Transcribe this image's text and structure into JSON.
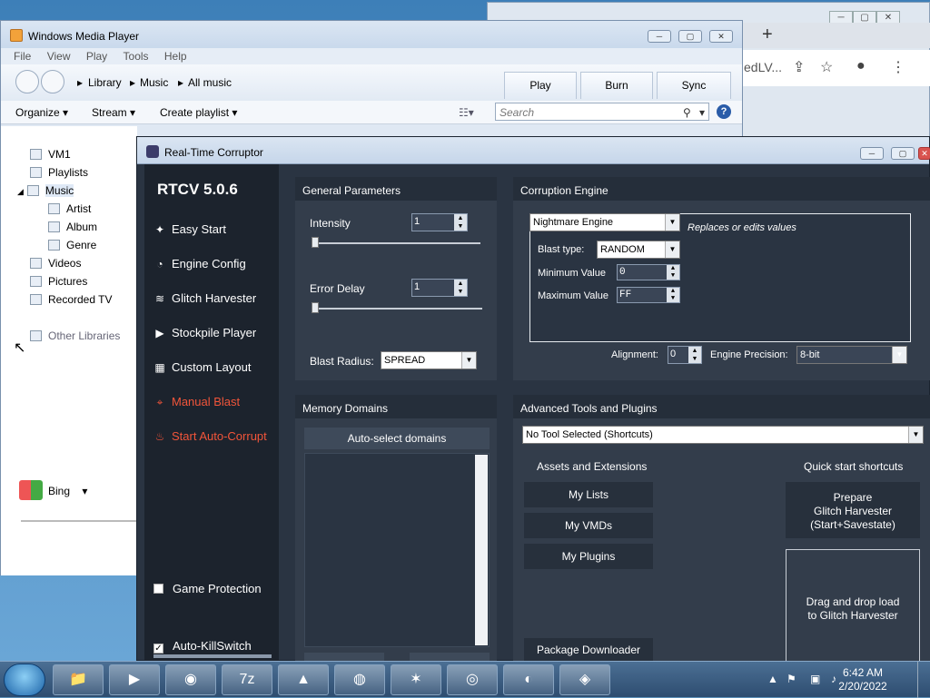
{
  "wmp": {
    "title": "Windows Media Player",
    "menus": [
      "File",
      "View",
      "Play",
      "Tools",
      "Help"
    ],
    "breadcrumb": [
      "Library",
      "Music",
      "All music"
    ],
    "tabs": {
      "play": "Play",
      "burn": "Burn",
      "sync": "Sync"
    },
    "commands": {
      "organize": "Organize",
      "stream": "Stream",
      "create_playlist": "Create playlist"
    },
    "search_placeholder": "Search",
    "library": {
      "vm1": "VM1",
      "playlists": "Playlists",
      "music": "Music",
      "artist": "Artist",
      "album": "Album",
      "genre": "Genre",
      "videos": "Videos",
      "pictures": "Pictures",
      "recorded_tv": "Recorded TV",
      "other_libraries": "Other Libraries"
    },
    "bing": "Bing"
  },
  "chrome": {
    "url_tail": "edLV..."
  },
  "rtcv": {
    "title": "Real-Time Corruptor",
    "version": "RTCV 5.0.6",
    "nav": {
      "easy_start": "Easy Start",
      "engine_config": "Engine Config",
      "glitch_harvester": "Glitch Harvester",
      "stockpile_player": "Stockpile Player",
      "custom_layout": "Custom Layout",
      "manual_blast": "Manual Blast",
      "auto_corrupt": "Start Auto-Corrupt"
    },
    "game_protection": "Game Protection",
    "auto_killswitch": "Auto-KillSwitch",
    "general": {
      "header": "General Parameters",
      "intensity_label": "Intensity",
      "intensity": "1",
      "error_delay_label": "Error Delay",
      "error_delay": "1",
      "blast_radius_label": "Blast Radius:",
      "blast_radius": "SPREAD"
    },
    "engine": {
      "header": "Corruption Engine",
      "engine": "Nightmare Engine",
      "desc": "Replaces or edits values",
      "blast_type_label": "Blast type:",
      "blast_type": "RANDOM",
      "min_label": "Minimum Value",
      "min": "0",
      "max_label": "Maximum Value",
      "max": "FF",
      "alignment_label": "Alignment:",
      "alignment": "0",
      "precision_label": "Engine Precision:",
      "precision": "8-bit"
    },
    "memory": {
      "header": "Memory Domains",
      "auto_select": "Auto-select domains"
    },
    "tools": {
      "header": "Advanced Tools and Plugins",
      "selected": "No Tool Selected (Shortcuts)",
      "assets_header": "Assets and Extensions",
      "my_lists": "My Lists",
      "my_vmds": "My VMDs",
      "my_plugins": "My Plugins",
      "package_downloader": "Package Downloader",
      "shortcuts_header": "Quick start shortcuts",
      "prepare": "Prepare\nGlitch Harvester\n(Start+Savestate)",
      "drag_drop": "Drag and drop load\nto Glitch Harvester"
    }
  },
  "taskbar": {
    "time": "6:42 AM",
    "date": "2/20/2022"
  }
}
